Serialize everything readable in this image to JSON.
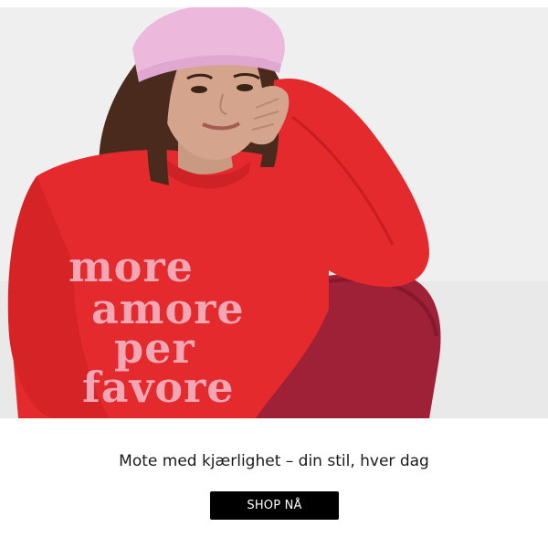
{
  "hero": {
    "sweater_text": [
      "more",
      "amore",
      "per",
      "favore"
    ]
  },
  "caption": "Mote med kjærlighet – din stil, hver dag",
  "cta_label": "SHOP NÅ",
  "colors": {
    "background": "#ededed",
    "sweater": "#e42a2c",
    "sweater_print": "#f3a7b5",
    "pants": "#9e2138",
    "beanie": "#ecb8dc",
    "button": "#000000"
  }
}
